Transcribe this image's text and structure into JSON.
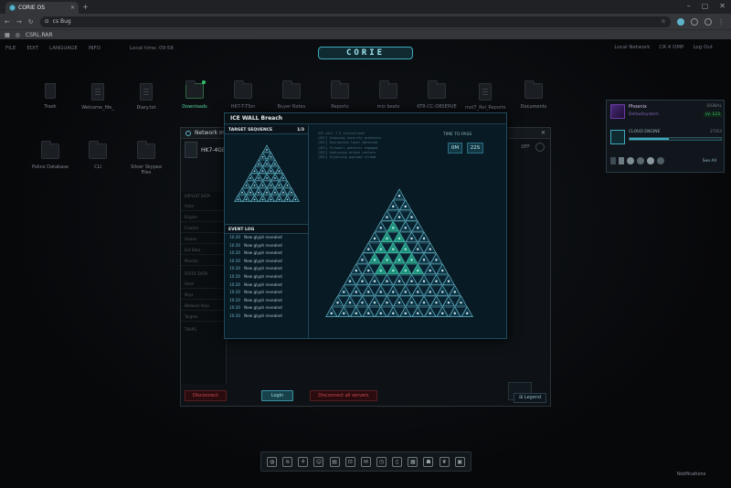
{
  "browser": {
    "tab_title": "CORIE OS",
    "url": "cs Bug",
    "bookmark": "CSRL.RAR"
  },
  "menubar": [
    "FILE",
    "EDIT",
    "LANGUAGE",
    "INFO",
    "Local time: 09:58"
  ],
  "logo": "CORIE",
  "topright": [
    "Local Network",
    "CR 4 OMP",
    "Log Out"
  ],
  "desktop_icons": [
    {
      "label": "Trash",
      "kind": "trash"
    },
    {
      "label": "Welcome_file_",
      "kind": "doc"
    },
    {
      "label": "Diary.txt",
      "kind": "doc"
    },
    {
      "label": "Downloads",
      "kind": "folder",
      "active": true
    },
    {
      "label": "HK7-T-TSm",
      "kind": "folder"
    },
    {
      "label": "Buyer Notes",
      "kind": "folder"
    },
    {
      "label": "Reports",
      "kind": "folder"
    },
    {
      "label": "mix beats",
      "kind": "folder"
    },
    {
      "label": "KTR-CC-OBSERVE",
      "kind": "folder"
    },
    {
      "label": "mst7_Rel_Reports",
      "kind": "doc"
    },
    {
      "label": "Documents",
      "kind": "folder"
    },
    {
      "label": "Police Database",
      "kind": "folder"
    },
    {
      "label": "CLI",
      "kind": "folder"
    },
    {
      "label": "Silver Skypea Files",
      "kind": "folder"
    }
  ],
  "network_window": {
    "title": "Network map",
    "node": "HK7-4GEF",
    "side_section_a": "EXPLOIT DATA",
    "side_rows_a": [
      "Actor",
      "Engine",
      "Cracker",
      "Gamer",
      "Ext Data",
      "Monitor"
    ],
    "side_section_b": "STATIC DATA",
    "side_rows_b": [
      "Hash",
      "Keys",
      "Network Keys",
      "Targets"
    ],
    "side_section_c": "TRAPS",
    "status_label": "OFF",
    "buttons": {
      "disconnect": "Disconnect",
      "login": "Login",
      "disconnect_all": "Disconnect all servers"
    },
    "legend": "Legend"
  },
  "ice": {
    "title": "ICE WALL Breach",
    "target_label": "TARGET SEQUENCE",
    "target_count": "1/3",
    "event_log_label": "EVENT LOG",
    "log": [
      {
        "time": "10:20",
        "msg": "New glyph revealed"
      },
      {
        "time": "10:20",
        "msg": "New glyph revealed"
      },
      {
        "time": "10:20",
        "msg": "New glyph revealed"
      },
      {
        "time": "10:20",
        "msg": "New glyph revealed"
      },
      {
        "time": "10:20",
        "msg": "New glyph revealed"
      },
      {
        "time": "10:20",
        "msg": "New glyph revealed"
      },
      {
        "time": "10:20",
        "msg": "New glyph revealed"
      },
      {
        "time": "10:20",
        "msg": "New glyph revealed"
      },
      {
        "time": "10:20",
        "msg": "New glyph revealed"
      },
      {
        "time": "10:20",
        "msg": "New glyph revealed"
      },
      {
        "time": "10:20",
        "msg": "New glyph revealed"
      }
    ],
    "console": [
      "ICE wall 7.3 initialized",
      "[SEC] Scanning security protocols",
      "[SEC] Encryption layer detected",
      "[SEC] Firewall patterns engaged",
      "[SEC] Analyzing attack vectors",
      "[SEC] Injecting payload stream"
    ],
    "time_label": "TIME TO PASS",
    "time_min": "0M",
    "time_sec": "22S"
  },
  "friend_panel": {
    "name": "Phoenix",
    "status": "SIGNAL",
    "handle": "Defaultsystem",
    "level": "LV. 123",
    "section": "CLOUD ENGINE",
    "meter": "27/63",
    "link": "See All"
  },
  "dock": [
    "globe",
    "wave",
    "flow",
    "user",
    "doc",
    "lock",
    "mail",
    "clock",
    "file",
    "grid",
    "person",
    "leaf",
    "box"
  ],
  "notifications": "Notifications",
  "colors": {
    "accent": "#3fb4c9",
    "danger": "#d04a4f",
    "background": "#08090b"
  }
}
